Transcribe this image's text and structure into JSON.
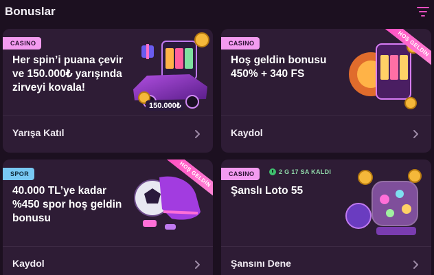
{
  "header": {
    "title": "Bonuslar",
    "filter_icon": "filter-lines-icon"
  },
  "cards": [
    {
      "category": "CASINO",
      "title": "Her spin’i puana çevir ve 150.000₺ yarışında zirveyi kovala!",
      "action": "Yarışa Katıl",
      "art_label": "150.000₺",
      "art_icon": "slot-car-icon"
    },
    {
      "category": "CASINO",
      "title": "Hoş geldin bonusu 450% + 340 FS",
      "action": "Kaydol",
      "ribbon": "HOŞ GELDİN",
      "art_icon": "slot-machine-icon"
    },
    {
      "category": "SPOR",
      "title": "40.000 TL’ye kadar %450 spor hoş geldin bonusu",
      "action": "Kaydol",
      "ribbon": "HOŞ GELDİN",
      "art_icon": "football-boot-icon"
    },
    {
      "category": "CASINO",
      "title": "Şanslı Loto 55",
      "action": "Şansını Dene",
      "countdown": "2 G 17 SA KALDI",
      "art_icon": "lottery-drum-icon"
    }
  ],
  "colors": {
    "background": "#1c1020",
    "card": "#2e1c35",
    "casino_badge": "#f39bf0",
    "spor_badge": "#78c8f3",
    "countdown": "#8fd6a8"
  }
}
